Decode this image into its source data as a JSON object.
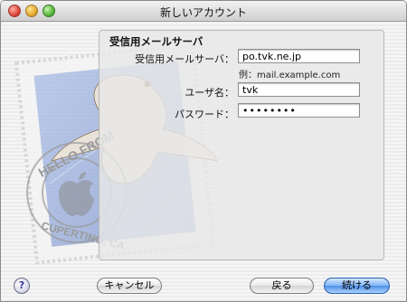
{
  "window": {
    "title": "新しいアカウント"
  },
  "panel": {
    "heading": "受信用メールサーバ"
  },
  "form": {
    "server_label": "受信用メールサーバ：",
    "server_value": "po.tvk.ne.jp",
    "server_hint": "例：mail.example.com",
    "user_label": "ユーザ名：",
    "user_value": "tvk",
    "password_label": "パスワード：",
    "password_value": "••••••••"
  },
  "buttons": {
    "help_label": "?",
    "cancel_label": "キャンセル",
    "back_label": "戻る",
    "continue_label": "続ける"
  },
  "stamp": {
    "line1": "HELLO FROM",
    "line2": "CUPERTINO, CA"
  },
  "colors": {
    "primary_button": "#4f8fe6",
    "stamp_blue": "#8fa6d8"
  }
}
